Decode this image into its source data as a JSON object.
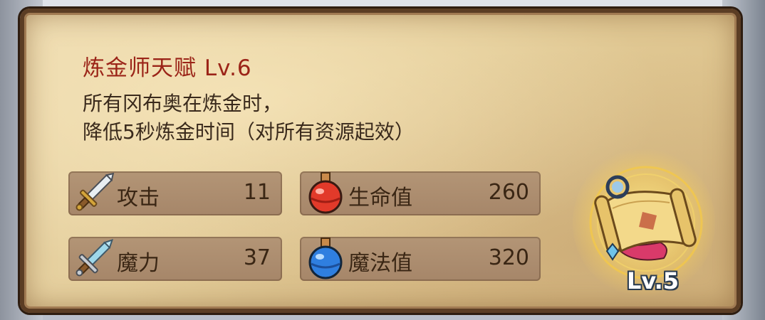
{
  "talent": {
    "title": "炼金师天赋 Lv.6",
    "description_lines": [
      "所有冈布奥在炼金时，",
      "降低5秒炼金时间（对所有资源起效）"
    ]
  },
  "stats": {
    "attack": {
      "label": "攻击",
      "value": "11",
      "icon": "sword-icon"
    },
    "magic": {
      "label": "魔力",
      "value": "37",
      "icon": "magic-sword-icon"
    },
    "hp": {
      "label": "生命值",
      "value": "260",
      "icon": "red-potion-icon"
    },
    "mp": {
      "label": "魔法值",
      "value": "320",
      "icon": "blue-potion-icon"
    }
  },
  "item": {
    "icon": "treasure-map-scroll-icon",
    "level": "Lv.5"
  },
  "colors": {
    "title": "#9b2418",
    "text": "#3a2a1c",
    "parchment": "#e3cc98",
    "stat_bar": "#a68669",
    "border": "#5b3d24"
  }
}
